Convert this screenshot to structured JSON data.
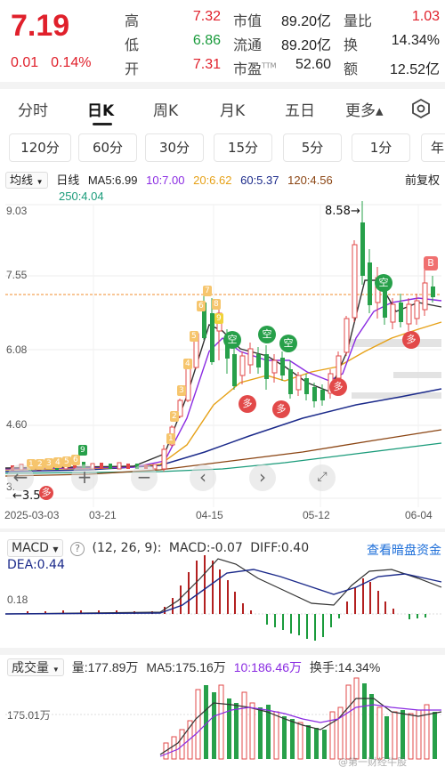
{
  "quote": {
    "price": "7.19",
    "change": "0.01",
    "change_pct": "0.14%",
    "high_label": "高",
    "high": "7.32",
    "low_label": "低",
    "low": "6.86",
    "open_label": "开",
    "open": "7.31",
    "mktcap_label": "市值",
    "mktcap": "89.20亿",
    "float_label": "流通",
    "float": "89.20亿",
    "pe_label": "市盈",
    "pe_sup": "TTM",
    "pe": "52.60",
    "volratio_label": "量比",
    "volratio": "1.03",
    "turnover_label": "换",
    "turnover": "14.34%",
    "amount_label": "额",
    "amount": "12.52亿"
  },
  "tabs": [
    {
      "label": "分时",
      "active": false
    },
    {
      "label": "日K",
      "active": true
    },
    {
      "label": "周K",
      "active": false
    },
    {
      "label": "月K",
      "active": false
    },
    {
      "label": "五日",
      "active": false
    },
    {
      "label": "更多▴",
      "active": false
    }
  ],
  "interval_buttons": [
    "120分",
    "60分",
    "30分",
    "15分",
    "5分",
    "1分",
    "年"
  ],
  "ma_legend": {
    "selector": "均线",
    "line": "日线",
    "ma5": "MA5:6.99",
    "ma10": "10:7.00",
    "ma20": "20:6.62",
    "ma60": "60:5.37",
    "ma120": "120:4.56",
    "ma250": "250:4.04",
    "adjust": "前复权"
  },
  "price_axis": [
    "9.03",
    "7.55",
    "6.08",
    "4.60",
    "3."
  ],
  "high_marker": "8.58→",
  "low_marker": "←3.57",
  "dates": [
    "2025-03-03",
    "03-21",
    "04-15",
    "05-12",
    "06-04"
  ],
  "buy_tag": "B",
  "macd": {
    "selector": "MACD",
    "params": "(12, 26, 9):",
    "macd": "MACD:-0.07",
    "diff": "DIFF:0.40",
    "dea": "DEA:0.44",
    "link": "查看暗盘资金",
    "axis": "0.18"
  },
  "volume": {
    "selector": "成交量",
    "vol": "量:177.89万",
    "ma5": "MA5:175.16万",
    "ma10": "10:186.46万",
    "turnover": "换手:14.34%",
    "axis": "175.01万"
  },
  "watermark": "@第一财经牛股"
}
